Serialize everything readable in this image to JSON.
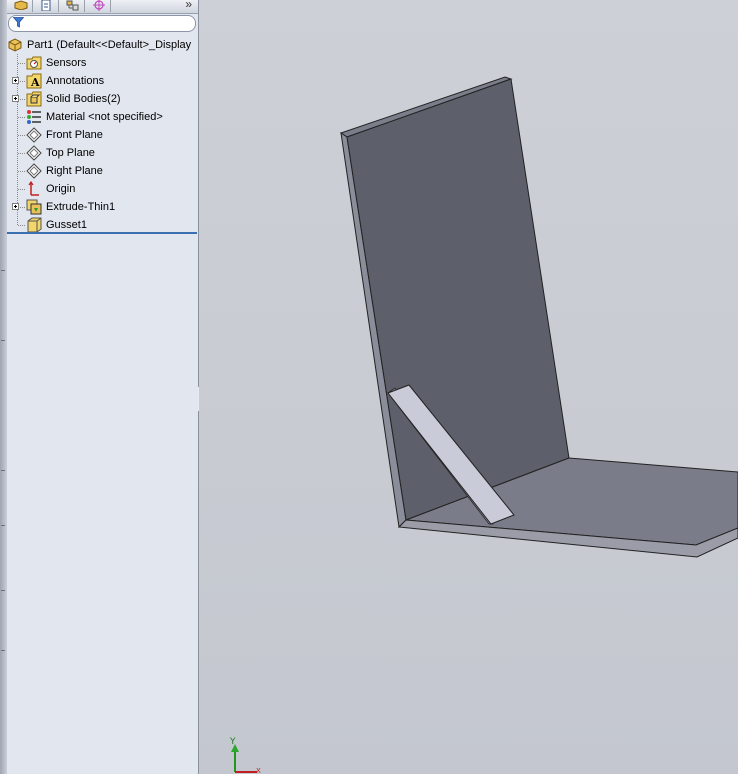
{
  "tabs": {
    "feature_manager_icon": "part-icon",
    "property_manager_icon": "document-icon",
    "configuration_manager_icon": "configuration-icon",
    "dimxpert_icon": "crosshair-icon",
    "more_label": "»"
  },
  "filter": {
    "icon": "filter-icon",
    "value": ""
  },
  "tree": {
    "root": {
      "label": "Part1  (Default<<Default>_Display",
      "icon": "part-icon"
    },
    "items": [
      {
        "label": "Sensors",
        "icon": "sensors-icon",
        "expandable": false
      },
      {
        "label": "Annotations",
        "icon": "annotations-icon",
        "expandable": true
      },
      {
        "label": "Solid Bodies(2)",
        "icon": "solid-bodies-folder-icon",
        "expandable": true
      },
      {
        "label": "Material <not specified>",
        "icon": "material-icon",
        "expandable": false
      },
      {
        "label": "Front Plane",
        "icon": "plane-icon",
        "expandable": false
      },
      {
        "label": "Top Plane",
        "icon": "plane-icon",
        "expandable": false
      },
      {
        "label": "Right Plane",
        "icon": "plane-icon",
        "expandable": false
      },
      {
        "label": "Origin",
        "icon": "origin-icon",
        "expandable": false
      },
      {
        "label": "Extrude-Thin1",
        "icon": "extrude-icon",
        "expandable": true
      },
      {
        "label": "Gusset1",
        "icon": "gusset-icon",
        "expandable": false
      }
    ]
  },
  "viewport": {
    "triad_axis_label": "Y",
    "triad_x_label": "X",
    "model_face_color": "#5e616b",
    "model_bottom_color": "#7a7d89",
    "gusset_color": "#c9cbd8"
  }
}
